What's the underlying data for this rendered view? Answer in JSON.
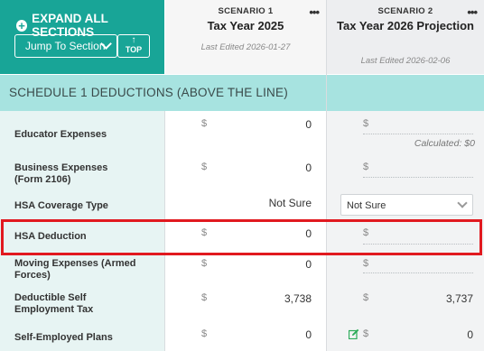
{
  "header": {
    "expand_label": "EXPAND ALL SECTIONS",
    "jump_label": "Jump To Section",
    "top_label": "TOP",
    "top_arrow": "↑"
  },
  "scenarios": [
    {
      "label": "SCENARIO 1",
      "name": "Tax Year 2025",
      "last_edited": "Last Edited 2026-01-27",
      "more": "•••"
    },
    {
      "label": "SCENARIO 2",
      "name": "Tax Year 2026 Projection",
      "last_edited": "Last Edited 2026-02-06",
      "more": "•••"
    }
  ],
  "section": {
    "title": "SCHEDULE 1 DEDUCTIONS (ABOVE THE LINE)"
  },
  "rows": [
    {
      "label": "Educator Expenses",
      "s1_currency": "$",
      "s1_value": "0",
      "s2_currency": "$",
      "s2_value": "",
      "s2_note": "Calculated: $0"
    },
    {
      "label": "Business Expenses (Form 2106)",
      "s1_currency": "$",
      "s1_value": "0",
      "s2_currency": "$",
      "s2_value": ""
    },
    {
      "label": "HSA Coverage Type",
      "s1_value": "Not Sure",
      "s2_select": "Not Sure"
    },
    {
      "label": "HSA Deduction",
      "s1_currency": "$",
      "s1_value": "0",
      "s2_currency": "$",
      "s2_value": ""
    },
    {
      "label": "Moving Expenses (Armed Forces)",
      "s1_currency": "$",
      "s1_value": "0",
      "s2_currency": "$",
      "s2_value": ""
    },
    {
      "label": "Deductible Self Employment Tax",
      "s1_currency": "$",
      "s1_value": "3,738",
      "s2_currency": "$",
      "s2_value": "3,737"
    },
    {
      "label": "Self-Employed Plans",
      "s1_currency": "$",
      "s1_value": "0",
      "s2_currency": "$",
      "s2_value": "0"
    }
  ],
  "colors": {
    "header_teal": "#18a597",
    "section_band": "#a7e3e0",
    "label_column": "#e7f4f3",
    "highlight": "#e1191f"
  }
}
